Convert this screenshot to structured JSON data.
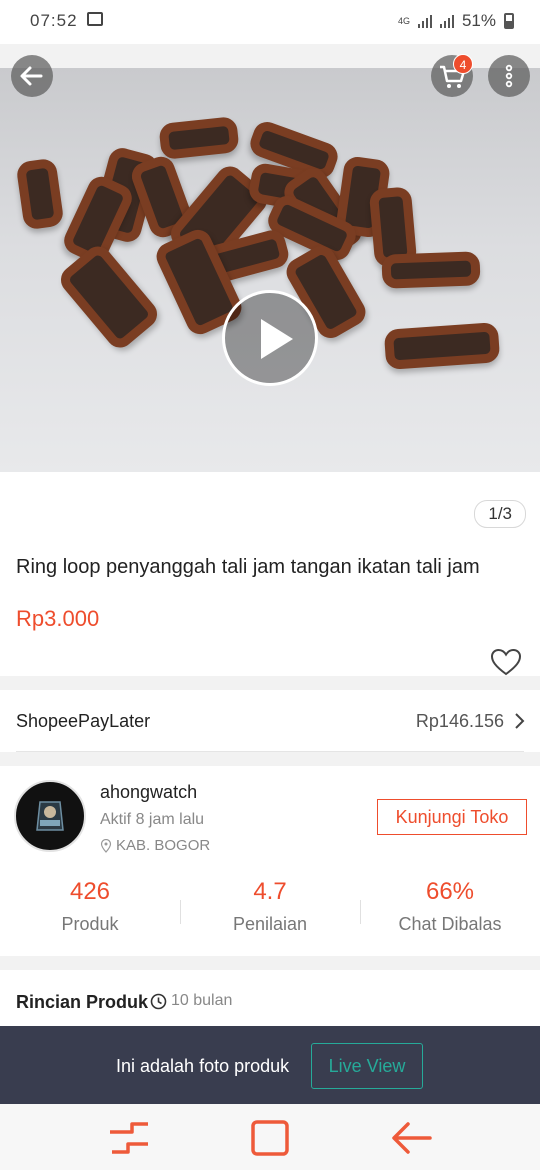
{
  "status_bar": {
    "time": "07:52",
    "network": "4G",
    "battery": "51%",
    "icons": [
      "image-icon",
      "signal-icon",
      "battery-icon"
    ]
  },
  "top_actions": {
    "back_icon": "arrow-left-icon",
    "cart_icon": "shopping-cart-icon",
    "cart_count": "4",
    "more_icon": "vertical-dots-icon"
  },
  "media": {
    "play_icon": "play-icon",
    "counter": "1/3"
  },
  "product": {
    "title": "Ring loop penyanggah tali jam tangan ikatan tali jam",
    "price": "Rp3.000",
    "favorite_icon": "heart-outline-icon"
  },
  "paylater": {
    "label": "ShopeePayLater",
    "amount": "Rp146.156"
  },
  "shop": {
    "name": "ahongwatch",
    "active": "Aktif 8 jam lalu",
    "location": "KAB. BOGOR",
    "visit_label": "Kunjungi Toko",
    "stats": [
      {
        "value": "426",
        "label": "Produk"
      },
      {
        "value": "4.7",
        "label": "Penilaian"
      },
      {
        "value": "66%",
        "label": "Chat Dibalas"
      }
    ]
  },
  "details": {
    "title": "Rincian Produk",
    "time": "10 bulan"
  },
  "live_banner": {
    "text": "Ini adalah foto produk",
    "button": "Live View"
  },
  "colors": {
    "accent": "#ee4d2d",
    "teal": "#26aa99",
    "banner_bg": "#393d4f",
    "product_leather": "#7a3d22"
  }
}
